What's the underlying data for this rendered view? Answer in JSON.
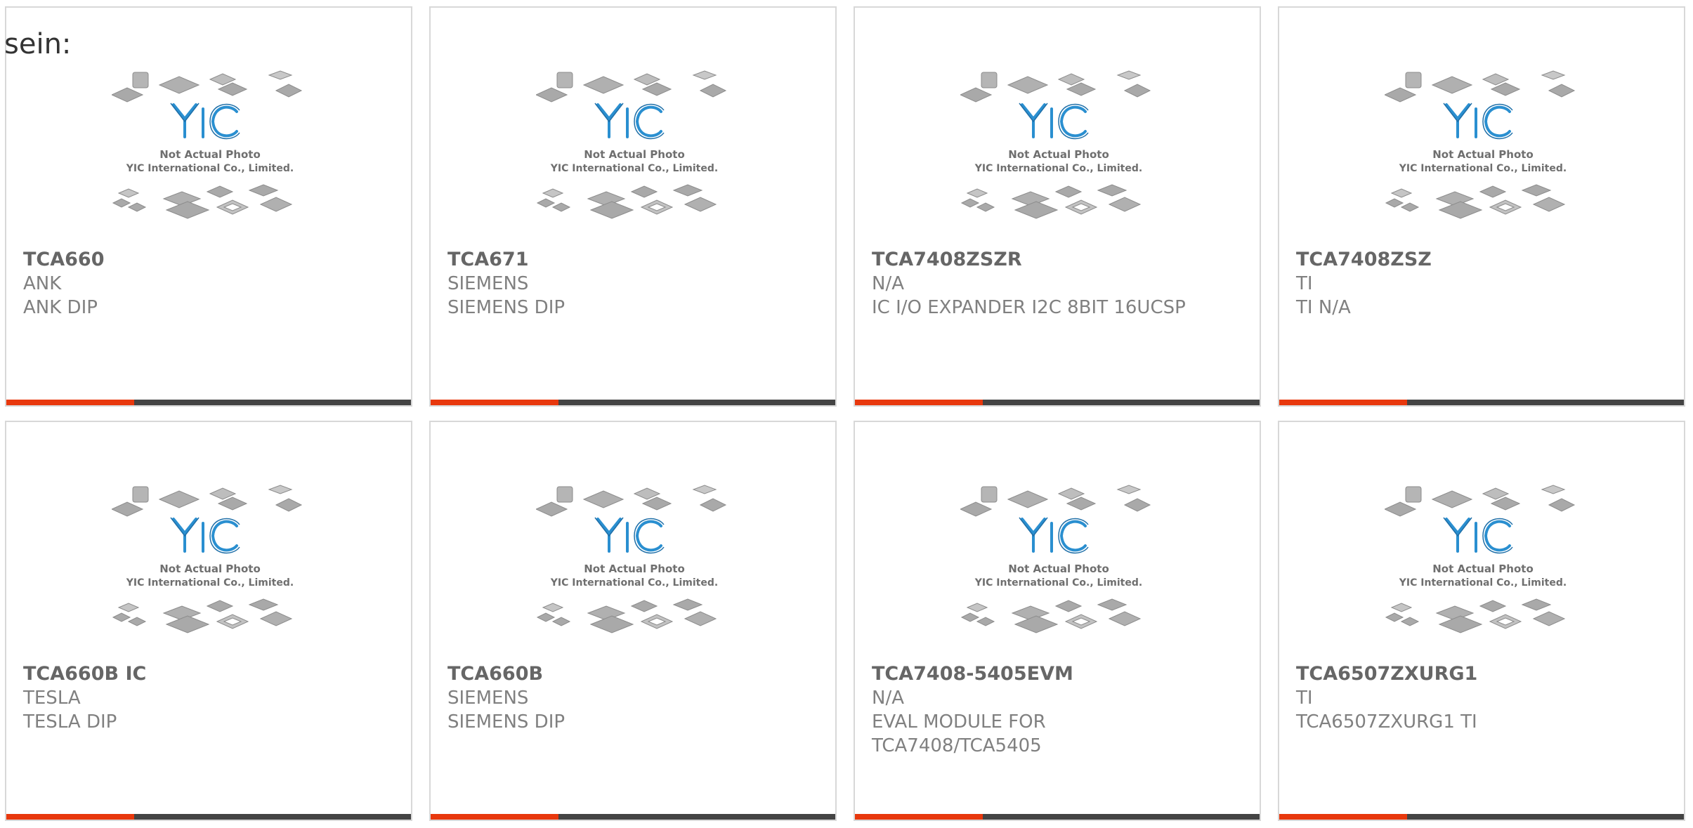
{
  "page": {
    "label": "sein:"
  },
  "placeholder": {
    "line1": "Not Actual Photo",
    "line2": "YIC International Co., Limited.",
    "logo": "YIC",
    "logo_color": "#2a8fd0",
    "icon": "ic-chip-collage-icon"
  },
  "colors": {
    "bar_accent": "#e8380d",
    "bar_dark": "#444444",
    "card_border": "#d8d8d8"
  },
  "products": [
    {
      "part": "TCA660",
      "manufacturer": "ANK",
      "description": "ANK DIP"
    },
    {
      "part": "TCA671",
      "manufacturer": "SIEMENS",
      "description": "SIEMENS DIP"
    },
    {
      "part": "TCA7408ZSZR",
      "manufacturer": "N/A",
      "description": "IC I/O EXPANDER I2C 8BIT 16UCSP"
    },
    {
      "part": "TCA7408ZSZ",
      "manufacturer": "TI",
      "description": "TI N/A"
    },
    {
      "part": "TCA660B IC",
      "manufacturer": "TESLA",
      "description": "TESLA DIP"
    },
    {
      "part": "TCA660B",
      "manufacturer": "SIEMENS",
      "description": "SIEMENS DIP"
    },
    {
      "part": "TCA7408-5405EVM",
      "manufacturer": "N/A",
      "description": "EVAL MODULE FOR TCA7408/TCA5405"
    },
    {
      "part": "TCA6507ZXURG1",
      "manufacturer": "TI",
      "description": "TCA6507ZXURG1 TI"
    }
  ]
}
